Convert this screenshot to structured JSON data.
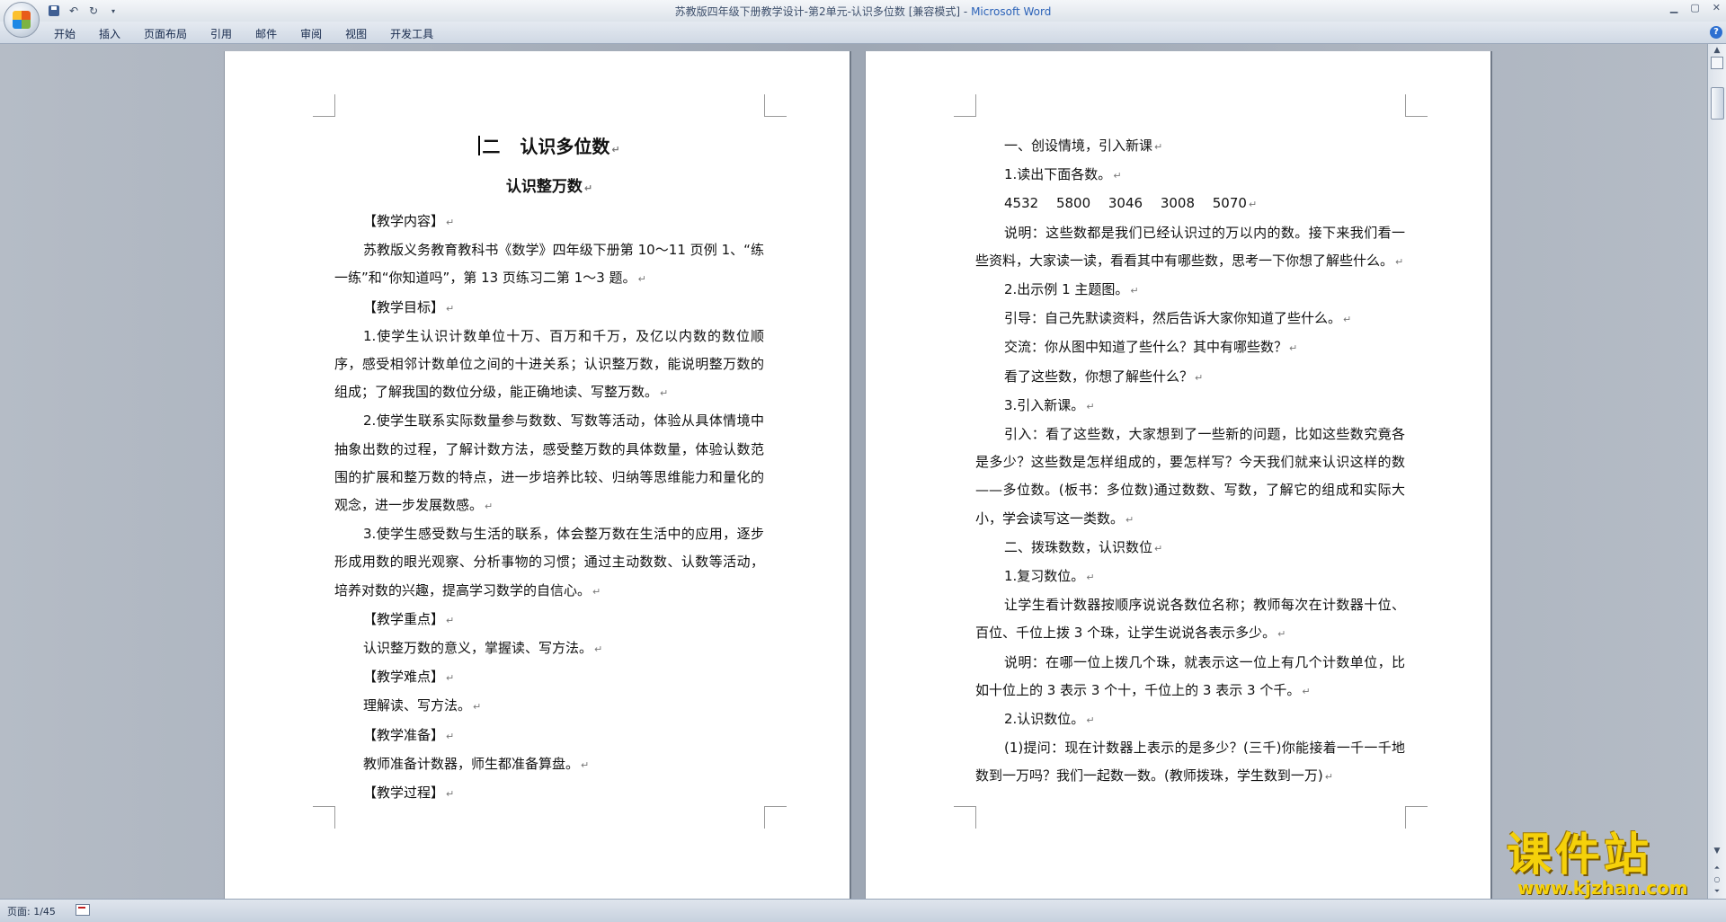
{
  "window": {
    "title_doc": "苏教版四年级下册教学设计-第2单元-认识多位数 [兼容模式]",
    "title_separator": " - ",
    "title_app": "Microsoft Word"
  },
  "ribbon": {
    "tabs": [
      "开始",
      "插入",
      "页面布局",
      "引用",
      "邮件",
      "审阅",
      "视图",
      "开发工具"
    ],
    "help_label": "?"
  },
  "status": {
    "page_count": "页面: 1/45"
  },
  "page1": {
    "title_prefix": "二",
    "title": "认识多位数",
    "subtitle": "认识整万数",
    "paragraphs": [
      {
        "t": "【教学内容】",
        "i": true
      },
      {
        "t": "苏教版义务教育教科书《数学》四年级下册第 10～11 页例 1、“练一练”和“你知道吗”，第 13 页练习二第 1～3 题。",
        "i": true
      },
      {
        "t": "【教学目标】",
        "i": true
      },
      {
        "t": "1.使学生认识计数单位十万、百万和千万，及亿以内数的数位顺序，感受相邻计数单位之间的十进关系；认识整万数，能说明整万数的组成；了解我国的数位分级，能正确地读、写整万数。",
        "i": true
      },
      {
        "t": "2.使学生联系实际数量参与数数、写数等活动，体验从具体情境中抽象出数的过程，了解计数方法，感受整万数的具体数量，体验认数范围的扩展和整万数的特点，进一步培养比较、归纳等思维能力和量化的观念，进一步发展数感。",
        "i": true
      },
      {
        "t": "3.使学生感受数与生活的联系，体会整万数在生活中的应用，逐步形成用数的眼光观察、分析事物的习惯；通过主动数数、认数等活动，培养对数的兴趣，提高学习数学的自信心。",
        "i": true
      },
      {
        "t": "【教学重点】",
        "i": true
      },
      {
        "t": "认识整万数的意义，掌握读、写方法。",
        "i": true
      },
      {
        "t": "【教学难点】",
        "i": true
      },
      {
        "t": "理解读、写方法。",
        "i": true
      },
      {
        "t": "【教学准备】",
        "i": true
      },
      {
        "t": "教师准备计数器，师生都准备算盘。",
        "i": true
      },
      {
        "t": "【教学过程】",
        "i": true
      }
    ]
  },
  "page2": {
    "paragraphs": [
      {
        "t": "一、创设情境，引入新课",
        "i": true
      },
      {
        "t": "1.读出下面各数。",
        "i": true
      },
      {
        "t": "4532　 5800　 3046　 3008　 5070",
        "i": true
      },
      {
        "t": "说明：这些数都是我们已经认识过的万以内的数。接下来我们看一些资料，大家读一读，看看其中有哪些数，思考一下你想了解些什么。",
        "i": true
      },
      {
        "t": "2.出示例 1 主题图。",
        "i": true
      },
      {
        "t": "引导：自己先默读资料，然后告诉大家你知道了些什么。",
        "i": true
      },
      {
        "t": "交流：你从图中知道了些什么？其中有哪些数？",
        "i": true
      },
      {
        "t": "看了这些数，你想了解些什么？",
        "i": true
      },
      {
        "t": "3.引入新课。",
        "i": true
      },
      {
        "t": "引入：看了这些数，大家想到了一些新的问题，比如这些数究竟各是多少？这些数是怎样组成的，要怎样写？今天我们就来认识这样的数——多位数。(板书：多位数)通过数数、写数，了解它的组成和实际大小，学会读写这一类数。",
        "i": true
      },
      {
        "t": "二、拨珠数数，认识数位",
        "i": true
      },
      {
        "t": "1.复习数位。",
        "i": true
      },
      {
        "t": "让学生看计数器按顺序说说各数位名称；教师每次在计数器十位、百位、千位上拨 3 个珠，让学生说说各表示多少。",
        "i": true
      },
      {
        "t": "说明：在哪一位上拨几个珠，就表示这一位上有几个计数单位，比如十位上的 3 表示 3 个十，千位上的 3 表示 3 个千。",
        "i": true
      },
      {
        "t": "2.认识数位。",
        "i": true
      },
      {
        "t": "(1)提问：现在计数器上表示的是多少？(三千)你能接着一千一千地数到一万吗？我们一起数一数。(教师拨珠，学生数到一万)",
        "i": true
      }
    ]
  },
  "paragraph_mark": "↵",
  "watermark": {
    "title": "课件站",
    "url": "www.kjzhan.com"
  },
  "colors": {
    "workspace": "#a9b0bb",
    "title_app": "#2b62b8",
    "watermark": "#f5d10a"
  }
}
